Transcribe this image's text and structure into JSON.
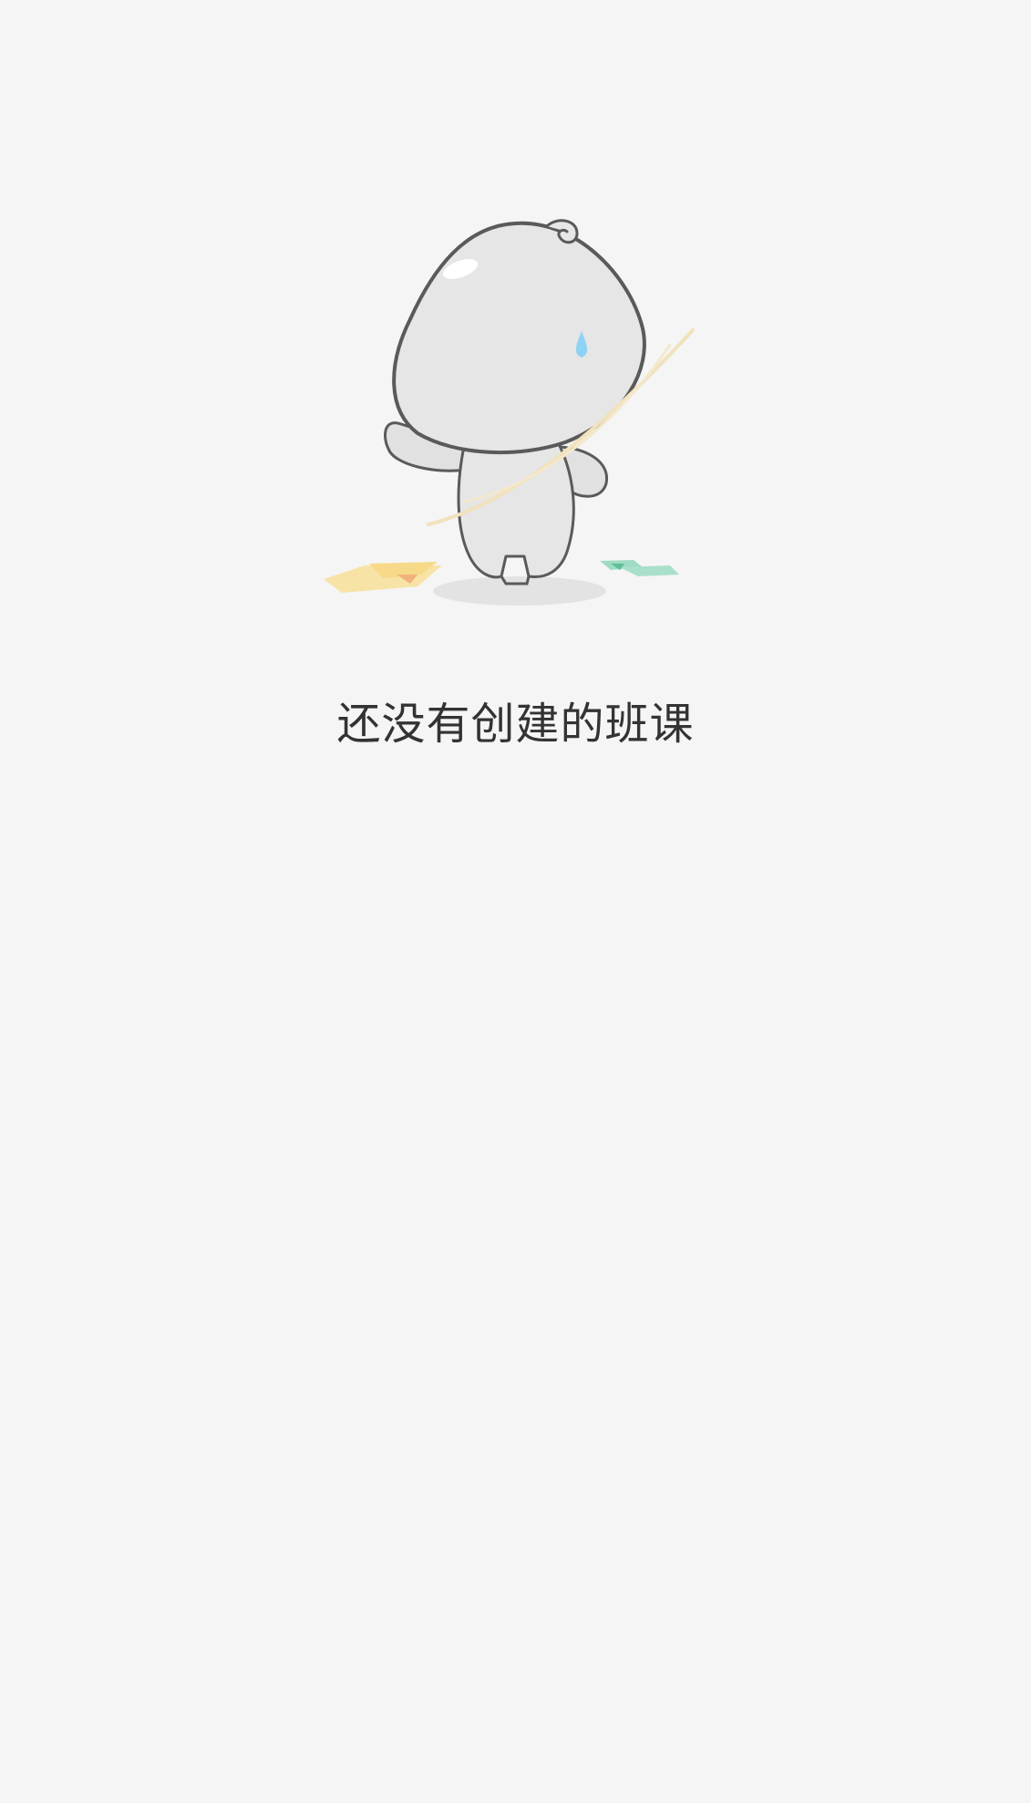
{
  "empty_state": {
    "message": "还没有创建的班课",
    "illustration_icon": "empty-mascot-icon"
  },
  "colors": {
    "background": "#f5f5f5",
    "text": "#333333",
    "mascot_body": "#e6e6e6",
    "mascot_outline": "#5a5a5a",
    "sweat_drop": "#8fd3f4",
    "paper_yellow": "#f7d98a",
    "paper_orange": "#f2b27c",
    "paper_green": "#7fd0b0"
  }
}
